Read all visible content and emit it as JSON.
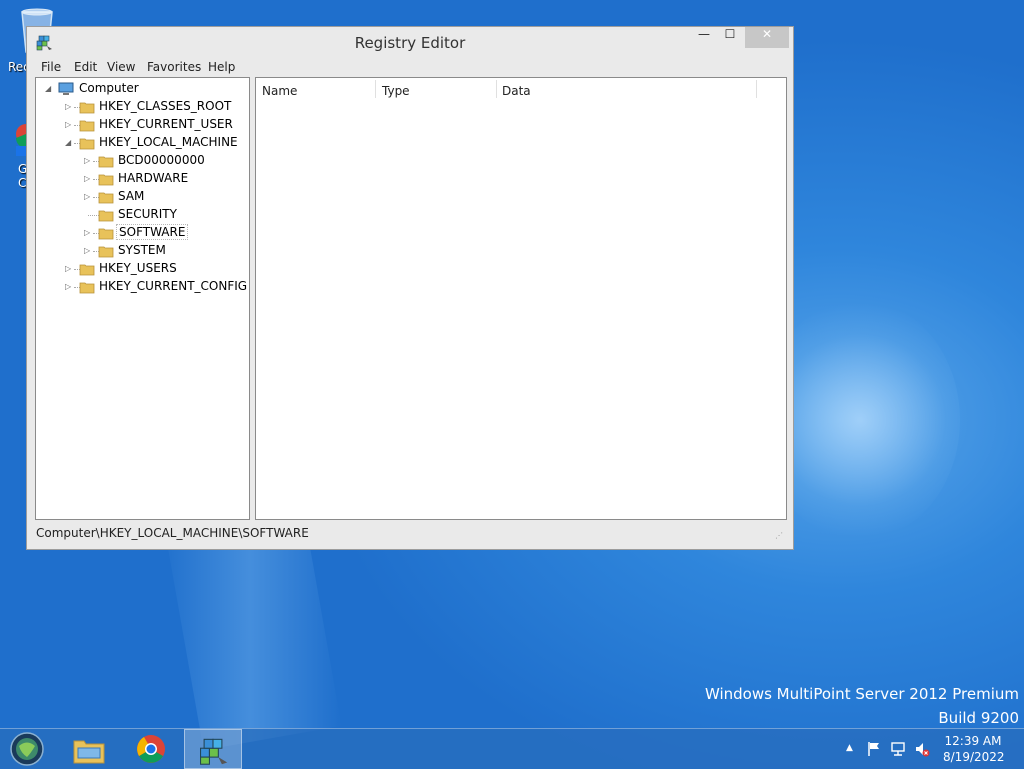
{
  "desktop": {
    "icons": [
      {
        "label": "Rec"
      },
      {
        "label": "G\nC"
      }
    ],
    "watermark": {
      "line1": "Windows MultiPoint Server 2012 Premium",
      "line2": "Build 9200"
    }
  },
  "window": {
    "title": "Registry Editor",
    "controls": {
      "minimize": "—",
      "maximize": "☐",
      "close": "✕"
    },
    "menu": [
      "File",
      "Edit",
      "View",
      "Favorites",
      "Help"
    ],
    "tree": {
      "root": "Computer",
      "hives": [
        {
          "label": "HKEY_CLASSES_ROOT"
        },
        {
          "label": "HKEY_CURRENT_USER"
        },
        {
          "label": "HKEY_LOCAL_MACHINE"
        },
        {
          "label": "HKEY_USERS"
        },
        {
          "label": "HKEY_CURRENT_CONFIG"
        }
      ],
      "lm_children": [
        {
          "label": "BCD00000000"
        },
        {
          "label": "HARDWARE"
        },
        {
          "label": "SAM"
        },
        {
          "label": "SECURITY"
        },
        {
          "label": "SOFTWARE"
        },
        {
          "label": "SYSTEM"
        }
      ],
      "selected": "SOFTWARE"
    },
    "columns": [
      {
        "label": "Name"
      },
      {
        "label": "Type"
      },
      {
        "label": "Data"
      }
    ],
    "status_path": "Computer\\HKEY_LOCAL_MACHINE\\SOFTWARE"
  },
  "taskbar": {
    "apps": [
      {
        "name": "server-manager"
      },
      {
        "name": "file-explorer"
      },
      {
        "name": "chrome"
      },
      {
        "name": "registry-editor",
        "active": true
      }
    ],
    "tray": {
      "show_hidden": "▲"
    },
    "clock": {
      "time": "12:39 AM",
      "date": "8/19/2022"
    }
  },
  "colors": {
    "folder": "#e8c25a",
    "accent": "#2f86dc",
    "close": "#c7c7c7"
  }
}
